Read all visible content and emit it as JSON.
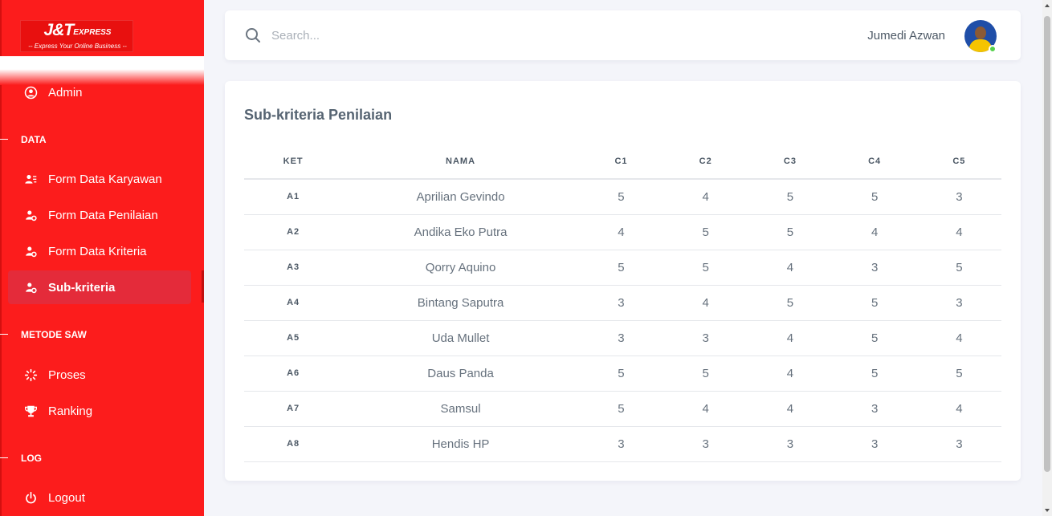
{
  "brand": {
    "logo_main": "J&T",
    "logo_express": "EXPRESS",
    "logo_tagline": "-- Express Your Online Business --",
    "color": "#fc1c1c"
  },
  "sidebar": {
    "user_item": {
      "label": "Admin",
      "icon": "user-circle-icon"
    },
    "sections": [
      {
        "label": "DATA"
      },
      {
        "label": "METODE SAW"
      },
      {
        "label": "LOG"
      }
    ],
    "items": [
      {
        "label": "Form Data Karyawan",
        "icon": "user-list-icon"
      },
      {
        "label": "Form Data Penilaian",
        "icon": "user-gear-icon"
      },
      {
        "label": "Form Data Kriteria",
        "icon": "user-gear-icon"
      },
      {
        "label": "Sub-kriteria",
        "icon": "user-gear-icon",
        "active": true
      },
      {
        "label": "Proses",
        "icon": "spinner-icon"
      },
      {
        "label": "Ranking",
        "icon": "trophy-icon"
      },
      {
        "label": "Logout",
        "icon": "power-icon"
      }
    ]
  },
  "header": {
    "search_placeholder": "Search...",
    "username": "Jumedi Azwan",
    "status": "online"
  },
  "card": {
    "title": "Sub-kriteria Penilaian"
  },
  "table": {
    "columns": [
      "KET",
      "NAMA",
      "C1",
      "C2",
      "C3",
      "C4",
      "C5"
    ],
    "rows": [
      {
        "ket": "A1",
        "nama": "Aprilian Gevindo",
        "c1": "5",
        "c2": "4",
        "c3": "5",
        "c4": "5",
        "c5": "3"
      },
      {
        "ket": "A2",
        "nama": "Andika Eko Putra",
        "c1": "4",
        "c2": "5",
        "c3": "5",
        "c4": "4",
        "c5": "4"
      },
      {
        "ket": "A3",
        "nama": "Qorry Aquino",
        "c1": "5",
        "c2": "5",
        "c3": "4",
        "c4": "3",
        "c5": "5"
      },
      {
        "ket": "A4",
        "nama": "Bintang Saputra",
        "c1": "3",
        "c2": "4",
        "c3": "5",
        "c4": "5",
        "c5": "3"
      },
      {
        "ket": "A5",
        "nama": "Uda Mullet",
        "c1": "3",
        "c2": "3",
        "c3": "4",
        "c4": "5",
        "c5": "4"
      },
      {
        "ket": "A6",
        "nama": "Daus Panda",
        "c1": "5",
        "c2": "5",
        "c3": "4",
        "c4": "5",
        "c5": "5"
      },
      {
        "ket": "A7",
        "nama": "Samsul",
        "c1": "5",
        "c2": "4",
        "c3": "4",
        "c4": "3",
        "c5": "4"
      },
      {
        "ket": "A8",
        "nama": "Hendis HP",
        "c1": "3",
        "c2": "3",
        "c3": "3",
        "c4": "3",
        "c5": "3"
      }
    ]
  }
}
